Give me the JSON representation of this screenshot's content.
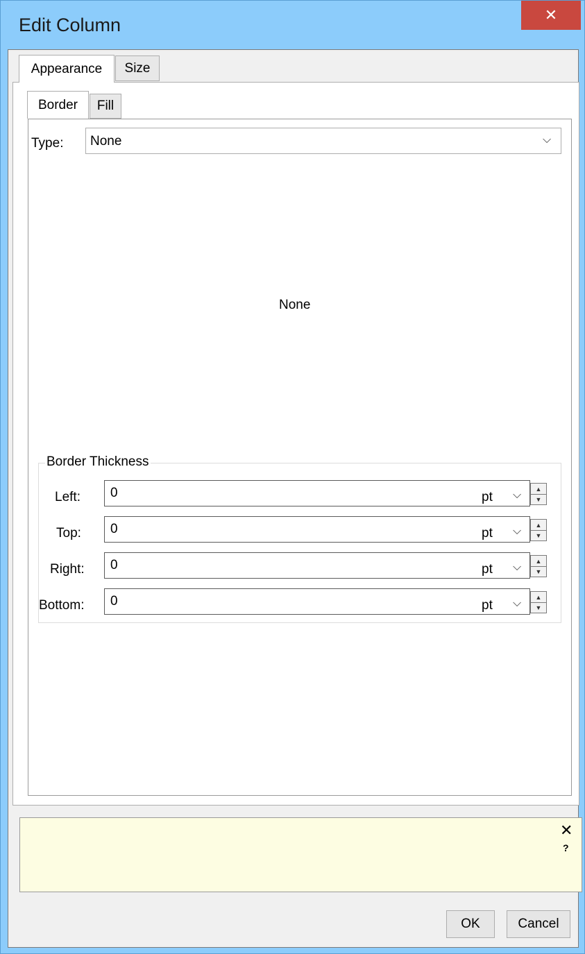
{
  "window": {
    "title": "Edit Column",
    "close_glyph": "✕"
  },
  "tabs": [
    {
      "label": "Appearance",
      "active": true
    },
    {
      "label": "Size",
      "active": false
    }
  ],
  "subtabs": [
    {
      "label": "Border",
      "active": true
    },
    {
      "label": "Fill",
      "active": false
    }
  ],
  "border": {
    "type_label": "Type:",
    "type_value": "None",
    "preview_text": "None"
  },
  "thickness": {
    "group_label": "Border Thickness",
    "fields": [
      {
        "label": "Left:",
        "value": "0",
        "unit": "pt"
      },
      {
        "label": "Top:",
        "value": "0",
        "unit": "pt"
      },
      {
        "label": "Right:",
        "value": "0",
        "unit": "pt"
      },
      {
        "label": "Bottom:",
        "value": "0",
        "unit": "pt"
      }
    ]
  },
  "help": {
    "close_glyph": "✕",
    "help_glyph": "?"
  },
  "buttons": {
    "ok": "OK",
    "cancel": "Cancel"
  }
}
